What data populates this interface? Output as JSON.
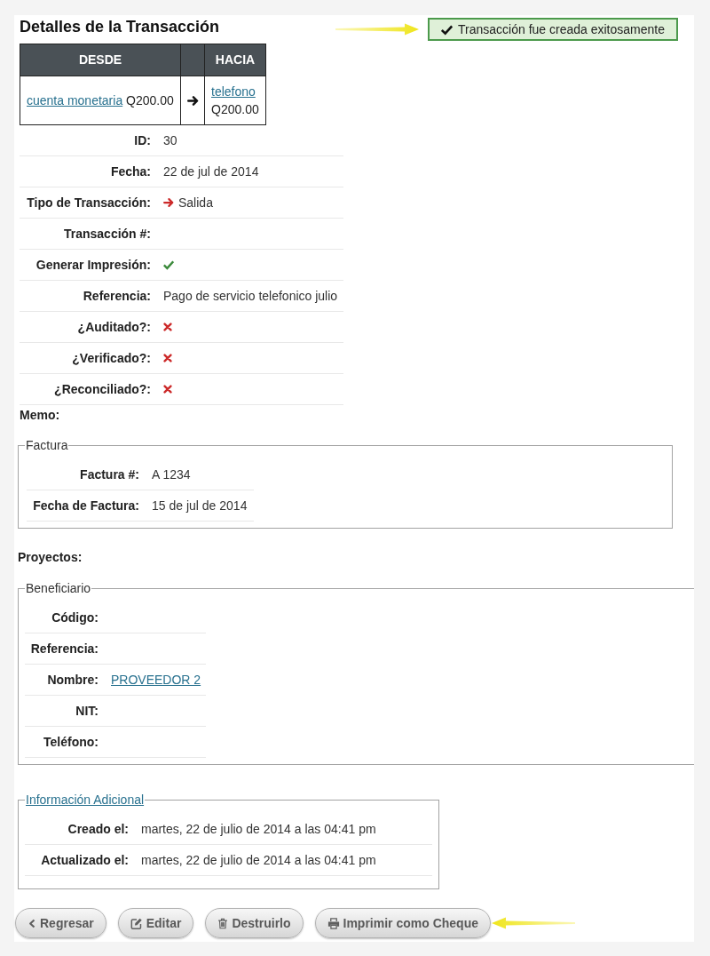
{
  "title": "Detalles de la Transacción",
  "alert": {
    "text": "Transacción fue creada exitosamente",
    "highlighted": true
  },
  "transfer_table": {
    "from_heading": "DESDE",
    "to_heading": "HACIA",
    "from": {
      "account": "cuenta monetaria",
      "amount": "Q200.00"
    },
    "to": {
      "account": "telefono",
      "amount": "Q200.00"
    }
  },
  "details": [
    {
      "label": "ID:",
      "kind": "text",
      "value": "30"
    },
    {
      "label": "Fecha:",
      "kind": "text",
      "value": "22 de jul de 2014"
    },
    {
      "label": "Tipo de Transacción:",
      "kind": "direction",
      "value": "Salida"
    },
    {
      "label": "Transacción #:",
      "kind": "text"
    },
    {
      "label": "Generar Impresión:",
      "kind": "flag",
      "checked": true
    },
    {
      "label": "Referencia:",
      "kind": "text",
      "value": "Pago de servicio telefonico julio"
    },
    {
      "label": "¿Auditado?:",
      "kind": "flag",
      "checked": false
    },
    {
      "label": "¿Verificado?:",
      "kind": "flag",
      "checked": false
    },
    {
      "label": "¿Reconciliado?:",
      "kind": "flag",
      "checked": false
    }
  ],
  "memo": {
    "label": "Memo:"
  },
  "invoice": {
    "legend": "Factura",
    "legend_link": false,
    "rows": [
      {
        "label": "Factura #:",
        "kind": "text",
        "value": "A 1234"
      },
      {
        "label": "Fecha de Factura:",
        "kind": "text",
        "value": "15 de jul de 2014"
      }
    ]
  },
  "projects": {
    "label": "Proyectos:"
  },
  "beneficiary": {
    "legend": "Beneficiario",
    "legend_link": false,
    "rows": [
      {
        "label": "Código:",
        "kind": "text"
      },
      {
        "label": "Referencia:",
        "kind": "text"
      },
      {
        "label": "Nombre:",
        "kind": "link",
        "value": "PROVEEDOR 2"
      },
      {
        "label": "NIT:",
        "kind": "text"
      },
      {
        "label": "Teléfono:",
        "kind": "text"
      }
    ]
  },
  "additional_info": {
    "legend": "Información Adicional",
    "legend_link": true,
    "rows": [
      {
        "label": "Creado el:",
        "kind": "text",
        "value": "martes, 22 de julio de 2014 a las 04:41 pm"
      },
      {
        "label": "Actualizado el:",
        "kind": "text",
        "value": "martes, 22 de julio de 2014 a las 04:41 pm"
      }
    ]
  },
  "buttons": [
    {
      "kind": "back",
      "label": "Regresar",
      "highlighted": false
    },
    {
      "kind": "edit",
      "label": "Editar",
      "highlighted": false
    },
    {
      "kind": "delete",
      "label": "Destruirlo",
      "highlighted": false
    },
    {
      "kind": "print",
      "label": "Imprimir como Cheque",
      "highlighted": true
    }
  ]
}
